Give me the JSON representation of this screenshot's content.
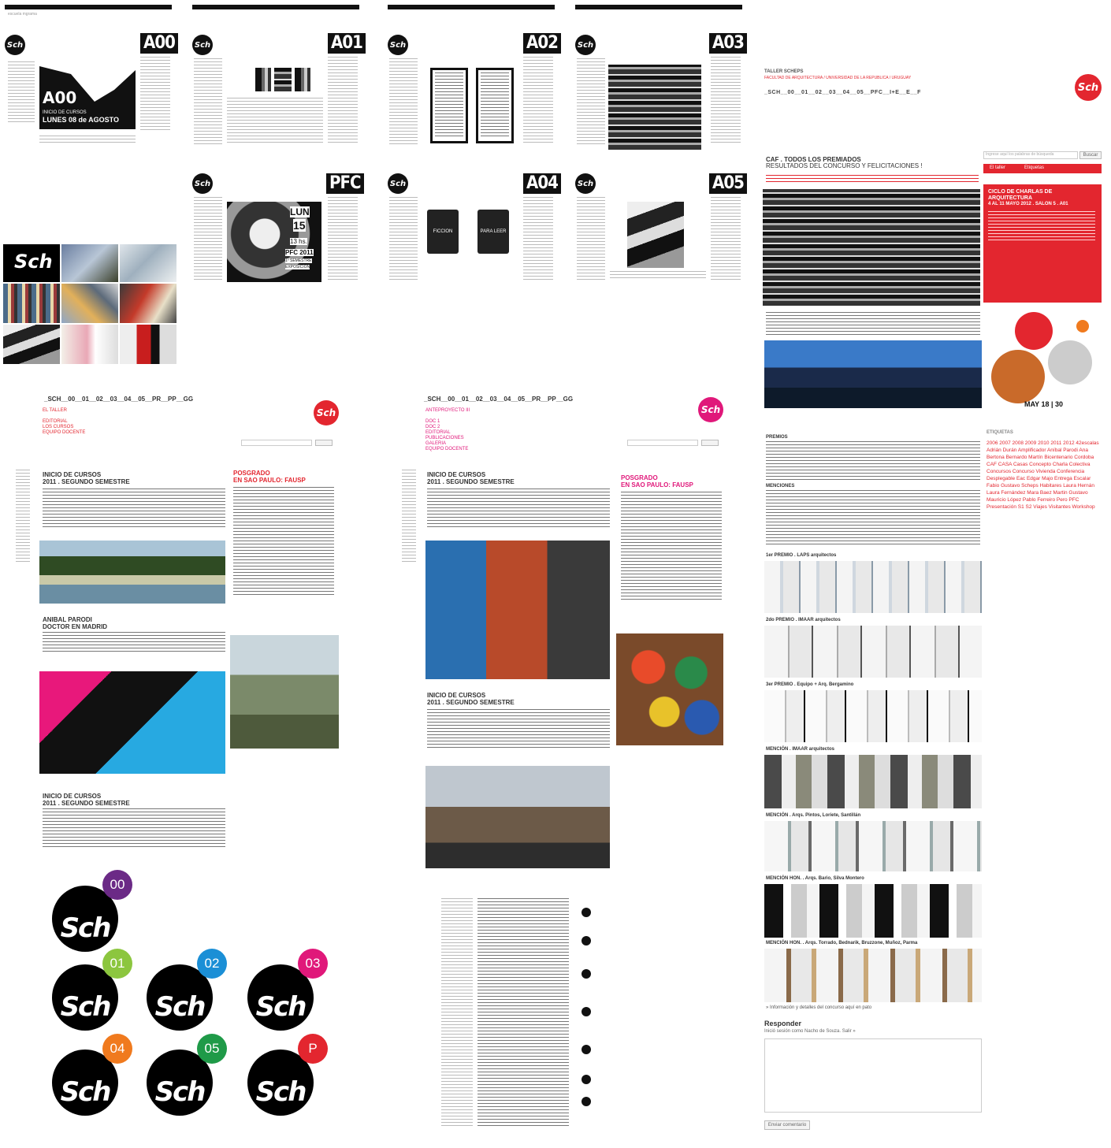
{
  "screens": {
    "a00": {
      "code": "A00",
      "hero_title": "A00",
      "hero_line1": "INICIO DE CURSOS",
      "hero_line2": "LUNES 08 de AGOSTO",
      "bar_text": "escuela mgrama"
    },
    "a01": {
      "code": "A01"
    },
    "a02": {
      "code": "A02"
    },
    "a03": {
      "code": "A03"
    },
    "pfc": {
      "code": "PFC",
      "day": "LUN",
      "date": "15",
      "time": "13 hs.",
      "line1": "PFC 2011",
      "line2": "1º SEMESTRE",
      "line3": "EXPOSICIÓN"
    },
    "a04": {
      "code": "A04",
      "book1": "FICCION",
      "book2": "PARA LEER"
    },
    "a05": {
      "code": "A05"
    }
  },
  "logo": "Sch",
  "collage_logo": "Sch",
  "site_nav_left": {
    "nav": "_SCH__00__01__02__03__04__05__PR__PP__GG",
    "subnav": [
      "EL TALLER"
    ],
    "links": [
      "EDITORIAL",
      "LOS CURSOS",
      "EQUIPO DOCENTE"
    ],
    "post1_title": [
      "INICIO DE CURSOS",
      "2011 . SEGUNDO SEMESTRE"
    ],
    "post2_title": [
      "ANIBAL PARODI",
      "DOCTOR EN MADRID"
    ],
    "post3_title": [
      "INICIO DE CURSOS",
      "2011 . SEGUNDO SEMESTRE"
    ],
    "side_title": [
      "POSGRADO",
      "EN SAO PAULO: FAUSP"
    ]
  },
  "site_nav_mid": {
    "nav": "_SCH__00__01__02__03__04__05__PR__PP__GG",
    "subnav": [
      "ANTEPROYECTO III"
    ],
    "links": [
      "DOC 1",
      "DOC 2",
      "EDITORIAL",
      "PUBLICACIONES",
      "GALERIA",
      "EQUIPO DOCENTE"
    ],
    "post1_title": [
      "INICIO DE CURSOS",
      "2011 . SEGUNDO SEMESTRE"
    ],
    "post2_title": [
      "INICIO DE CURSOS",
      "2011 . SEGUNDO SEMESTRE"
    ],
    "side_title": [
      "POSGRADO",
      "EN SAO PAULO: FAUSP"
    ]
  },
  "logo_set": [
    {
      "label": "00",
      "color": "#6b2a86"
    },
    {
      "label": "01",
      "color": "#8cc63f"
    },
    {
      "label": "02",
      "color": "#1b8fd6"
    },
    {
      "label": "03",
      "color": "#e0187a"
    },
    {
      "label": "04",
      "color": "#f07a1e"
    },
    {
      "label": "05",
      "color": "#1f9a48"
    },
    {
      "label": "P",
      "color": "#e3262f"
    }
  ],
  "blog": {
    "header_line1": "TALLER SCHEPS",
    "header_line2": "FACULTAD DE ARQUITECTURA / UNIVERSIDAD DE LA REPUBLICA / URUGUAY",
    "nav": "_SCH__00__01__02__03__04__05__PFC__I+E__E__F",
    "post_title": "CAF . TODOS LOS PREMIADOS",
    "post_subtitle": "RESULTADOS DEL CONCURSO Y FELICITACIONES !",
    "search_placeholder": "Ingrese aquí los palabras de búsqueda",
    "search_button": "Buscar",
    "tabs": [
      "El taller",
      "Etiquetas"
    ],
    "event_title": [
      "CICLO DE CHARLAS DE",
      "ARQUITECTURA"
    ],
    "event_date": "4 AL 11 MAYO 2012 . SALON 5 . A01",
    "poster_date": "MAY 18 | 30",
    "prizes_heading": "PREMIOS",
    "mentions_heading": "MENCIONES",
    "first_prize": "1er PREMIO . LAPS arquitectos",
    "second_prize": "2do PREMIO . IMAAR arquitectos",
    "third_prize": "3er PREMIO . Equipo + Arq. Bergamino",
    "mention1": "MENCIÓN . IMAAR arquitectos",
    "mention2": "MENCIÓN . Arqs. Pintos, Loriete, Santillán",
    "mention3": "MENCIÓN HON. . Arqs. Bario, Silva Montero",
    "mention4": "MENCIÓN HON. . Arqs. Torrado, Bednarik, Bruzzone, Muñoz, Parma",
    "footer_link": "» Información y detalles del concurso aquí en pato",
    "reply_heading": "Responder",
    "reply_login": "Inició sesión como Nacho de Souza. Salir »",
    "submit_button": "Enviar comentario",
    "tag_cloud": "2006 2007 2008 2009 2010 2011 2012 42escalas Adrián Durán Amplificador Aníbal Parodi Ana Bertona Bernardo Martín Bicentenario Cordoba CAF CASA Casas Concepto Charla Colectiva Concursos Concurso Vivienda Conferencia Desplegable Eac Edgar Majo Entrega Escalar Fabio Gustavo Scheps Habitares Laura Hernán Laura Fernández Mara Baez Martin Gustavo Mauricio López Pablo Ferreiro Pero PFC Presentación S1 S2 Viajes Visitantes Workshop"
  },
  "colors": {
    "red": "#e3262f",
    "pink": "#e0187a",
    "black": "#111111"
  }
}
